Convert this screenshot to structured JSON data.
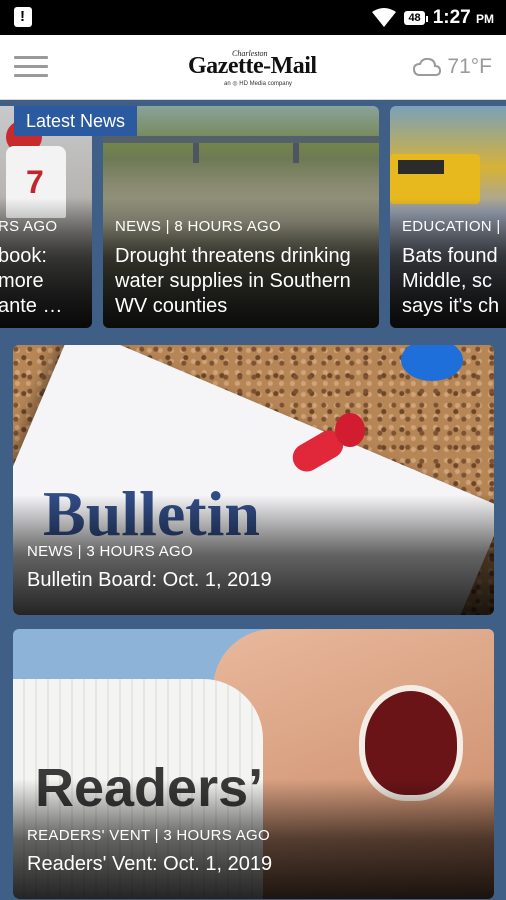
{
  "status_bar": {
    "battery": "48",
    "time": "1:27",
    "ampm": "PM"
  },
  "app_bar": {
    "logo_small": "Charleston",
    "logo_main": "Gazette-Mail",
    "logo_tag": "an ◎ HD Media company",
    "weather_temp": "71°F",
    "weather_icon": "cloud-icon"
  },
  "latest_news": {
    "label": "Latest News",
    "cards": [
      {
        "meta": "RS AGO",
        "title_lines": [
          "book:",
          "more",
          "ante …"
        ]
      },
      {
        "meta": "NEWS | 8 HOURS AGO",
        "title_lines": [
          "Drought threatens drinking",
          "water supplies in Southern",
          "WV counties"
        ]
      },
      {
        "meta": "EDUCATION |",
        "title_lines": [
          "Bats found",
          "Middle, sc",
          "says it's ch"
        ]
      }
    ]
  },
  "features": [
    {
      "meta": "NEWS | 3 HOURS AGO",
      "title": "Bulletin Board: Oct. 1, 2019",
      "image_word": "Bulletin"
    },
    {
      "meta": "READERS' VENT | 3 HOURS AGO",
      "title": "Readers' Vent: Oct. 1, 2019",
      "image_word": "Readers’"
    }
  ],
  "colors": {
    "background": "#3f5f86",
    "latest_label": "#2c5aa0"
  }
}
